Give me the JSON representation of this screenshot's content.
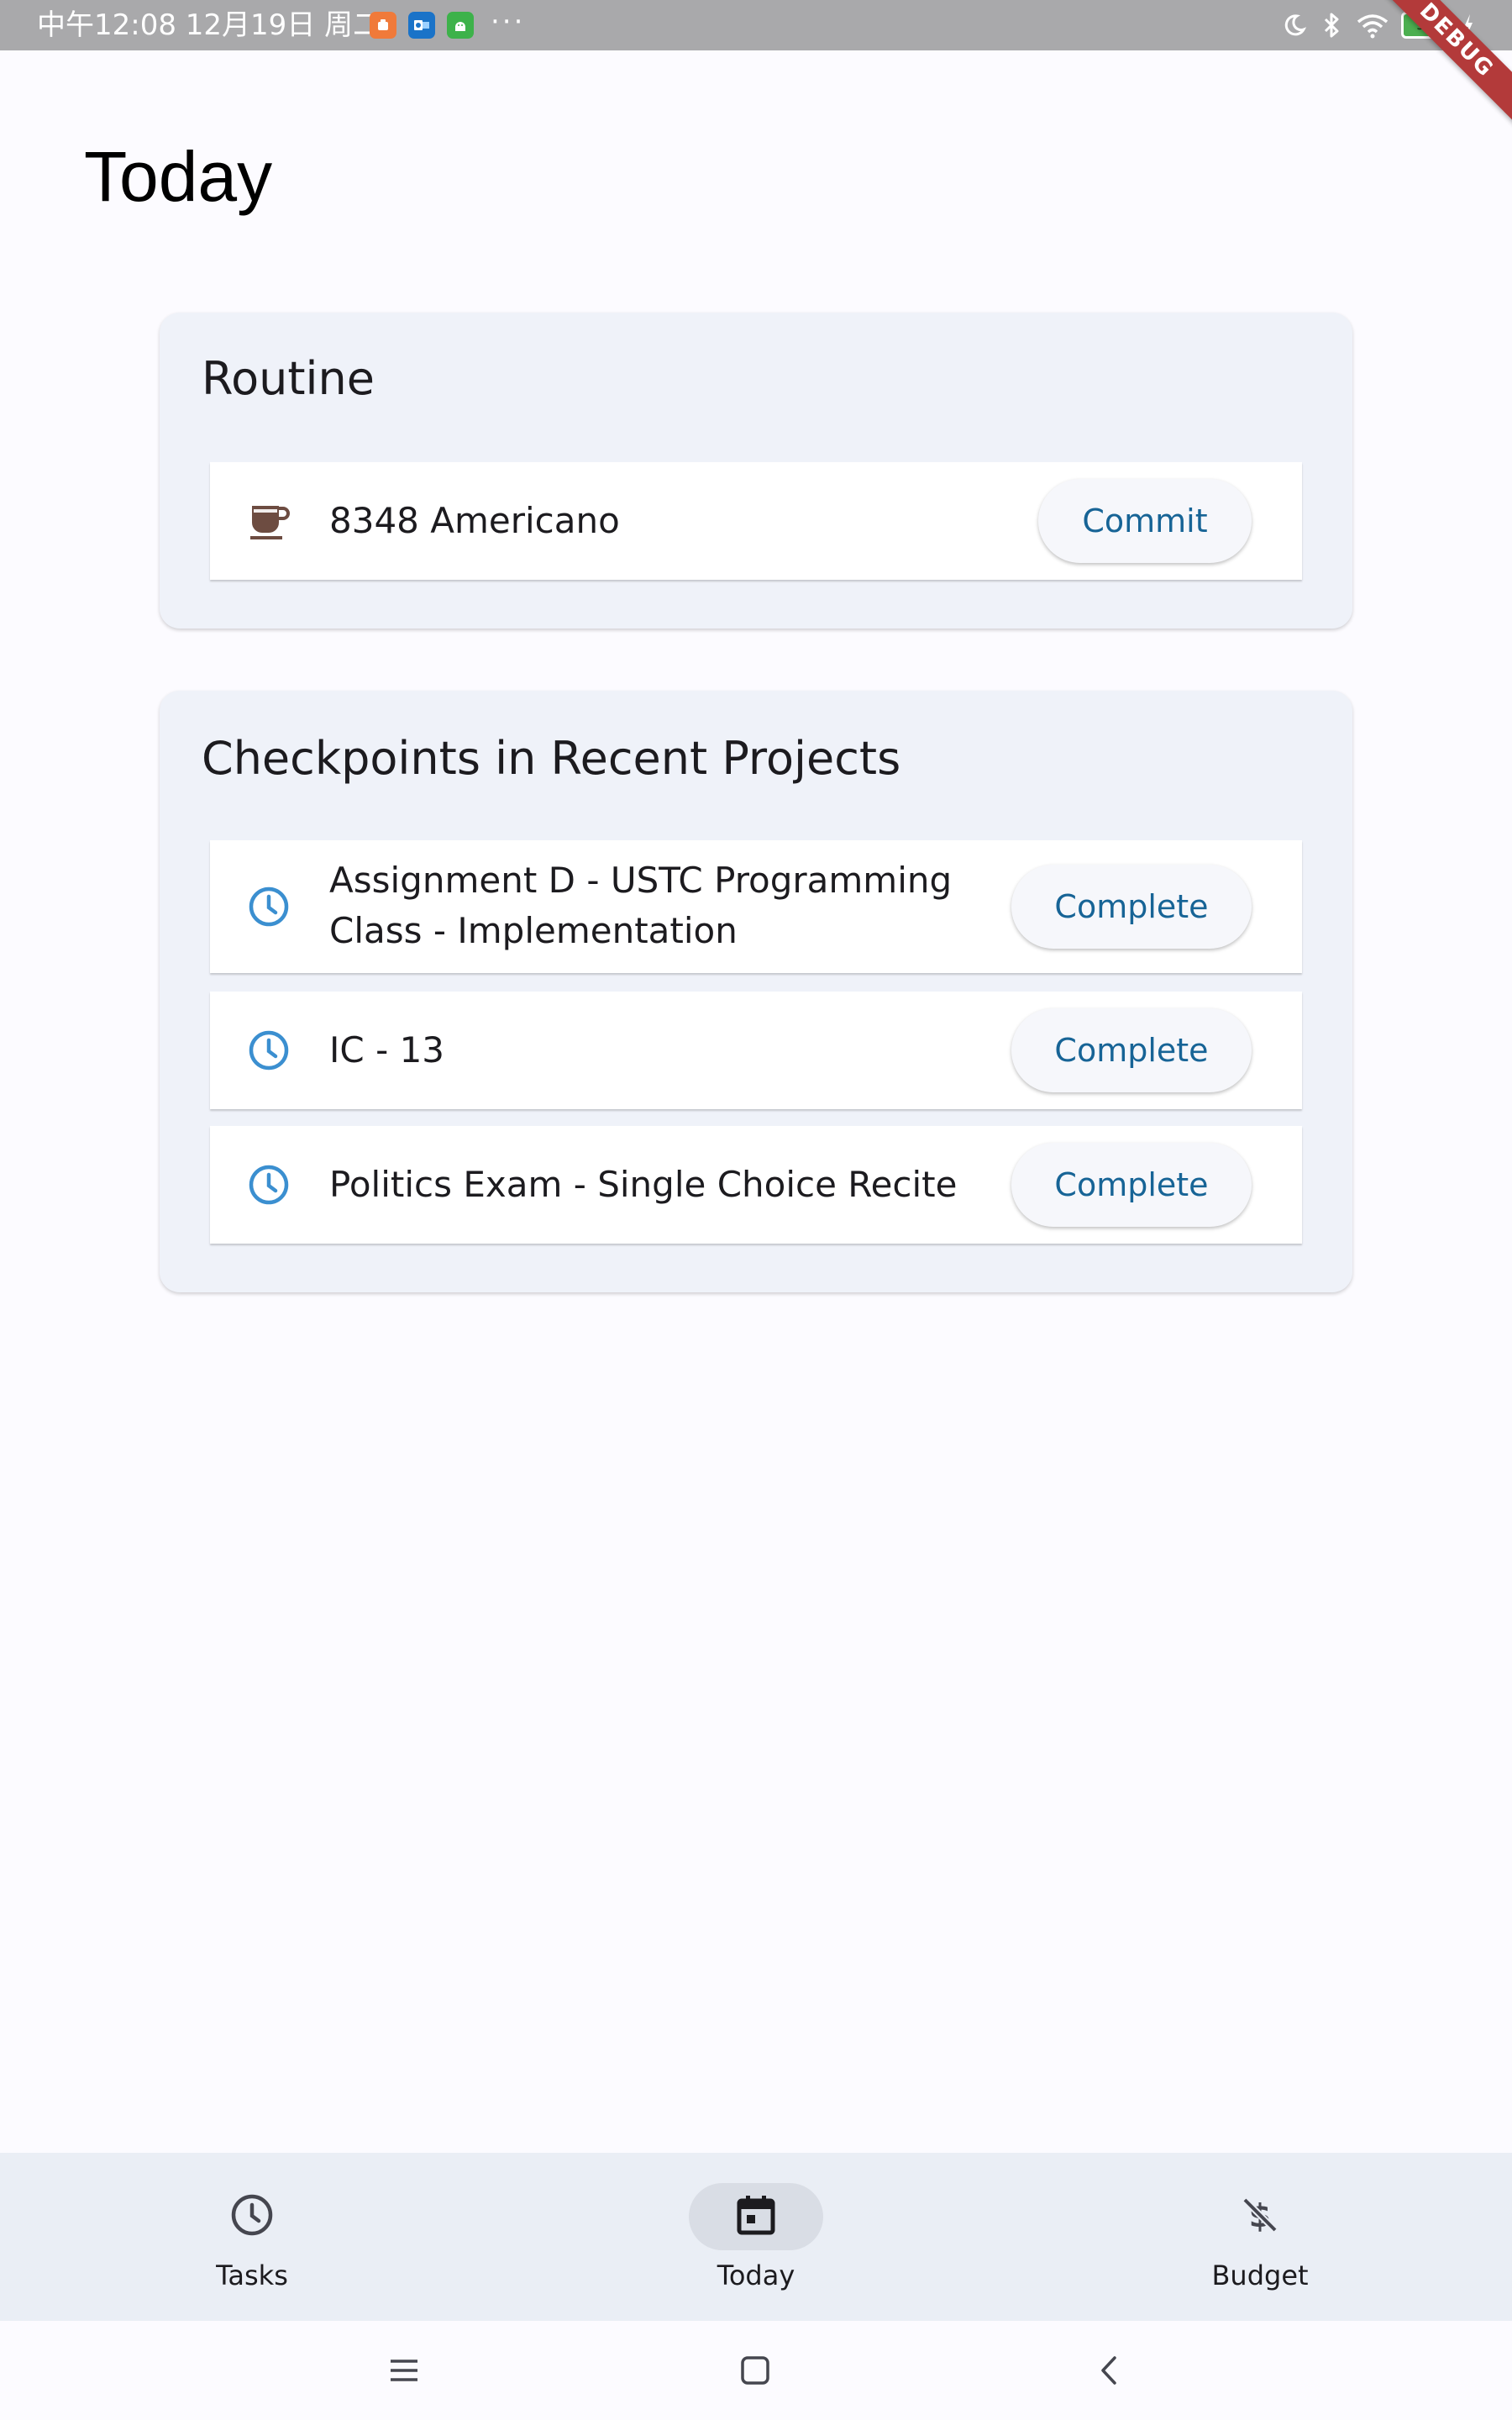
{
  "status_bar": {
    "time_text": "中午12:08 12月19日 周二",
    "notification_icons": [
      "app-notification-icon",
      "outlook-icon",
      "android-icon"
    ],
    "more_text": "···",
    "battery_level": "93"
  },
  "debug_banner": "DEBUG",
  "page_title": "Today",
  "routine": {
    "title": "Routine",
    "items": [
      {
        "label": "8348 Americano",
        "icon": "coffee-cup-icon",
        "button": "Commit"
      }
    ]
  },
  "checkpoints": {
    "title": "Checkpoints in Recent Projects",
    "items": [
      {
        "label": "Assignment D - USTC Programming Class - Implementation",
        "icon": "clock-icon",
        "button": "Complete"
      },
      {
        "label": "IC - 13",
        "icon": "clock-icon",
        "button": "Complete"
      },
      {
        "label": "Politics Exam - Single Choice Recite",
        "icon": "clock-icon",
        "button": "Complete"
      }
    ]
  },
  "bottom_nav": {
    "items": [
      {
        "label": "Tasks",
        "icon": "clock-icon",
        "active": false
      },
      {
        "label": "Today",
        "icon": "calendar-icon",
        "active": true
      },
      {
        "label": "Budget",
        "icon": "money-off-icon",
        "active": false
      }
    ]
  },
  "system_nav": [
    "menu-icon",
    "home-icon",
    "back-icon"
  ],
  "colors": {
    "accent": "#176496",
    "clock_icon": "#3b8fd0",
    "coffee_icon": "#6d4c41",
    "card_background": "#eff2f9",
    "nav_background": "#eaeef5",
    "status_bar": "#a9a9ab",
    "debug_ribbon": "#b33a3a"
  }
}
